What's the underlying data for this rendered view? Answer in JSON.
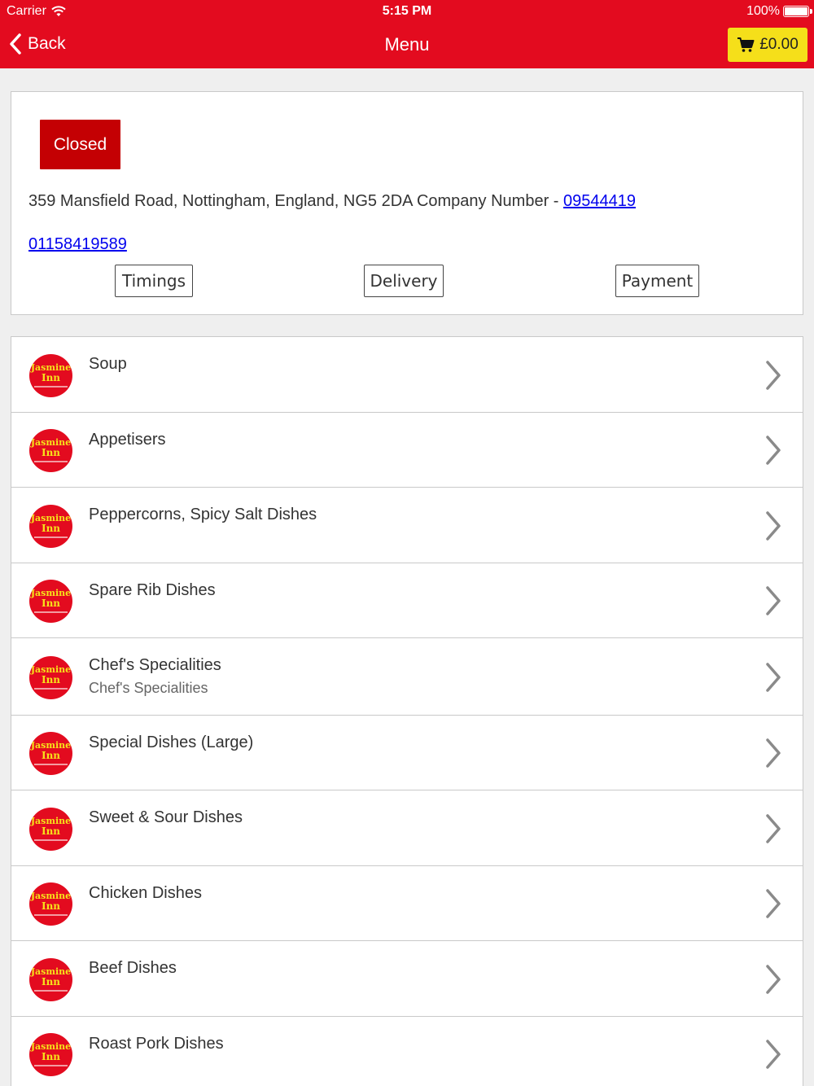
{
  "status_bar": {
    "carrier": "Carrier",
    "time": "5:15 PM",
    "battery": "100%"
  },
  "nav": {
    "back_label": "Back",
    "title": "Menu",
    "cart_total": "£0.00"
  },
  "info": {
    "status_badge": "Closed",
    "address": "359 Mansfield Road, Nottingham, England, NG5 2DA Company Number - ",
    "company_number": "09544419",
    "phone": "01158419589",
    "buttons": {
      "timings": "Timings",
      "delivery": "Delivery",
      "payment": "Payment"
    }
  },
  "logo": {
    "line1": "Jasmine",
    "line2": "Inn"
  },
  "categories": [
    {
      "title": "Soup",
      "subtitle": ""
    },
    {
      "title": "Appetisers",
      "subtitle": ""
    },
    {
      "title": "Peppercorns, Spicy Salt Dishes",
      "subtitle": ""
    },
    {
      "title": "Spare Rib Dishes",
      "subtitle": ""
    },
    {
      "title": "Chef's Specialities",
      "subtitle": "Chef's Specialities"
    },
    {
      "title": "Special Dishes (Large)",
      "subtitle": ""
    },
    {
      "title": "Sweet & Sour Dishes",
      "subtitle": ""
    },
    {
      "title": "Chicken Dishes",
      "subtitle": ""
    },
    {
      "title": "Beef Dishes",
      "subtitle": ""
    },
    {
      "title": "Roast Pork Dishes",
      "subtitle": ""
    }
  ],
  "colors": {
    "brand_red": "#e30b1f",
    "closed_red": "#c40003",
    "cart_yellow": "#f5df1a",
    "link_blue": "#0000ee"
  }
}
